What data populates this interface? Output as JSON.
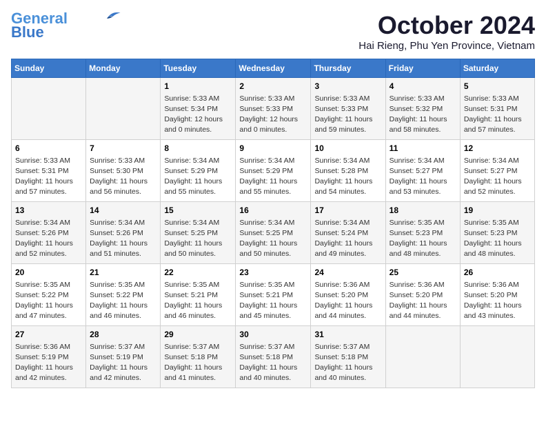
{
  "logo": {
    "line1": "General",
    "line2": "Blue"
  },
  "title": "October 2024",
  "location": "Hai Rieng, Phu Yen Province, Vietnam",
  "days_header": [
    "Sunday",
    "Monday",
    "Tuesday",
    "Wednesday",
    "Thursday",
    "Friday",
    "Saturday"
  ],
  "weeks": [
    [
      {
        "day": "",
        "info": ""
      },
      {
        "day": "",
        "info": ""
      },
      {
        "day": "1",
        "info": "Sunrise: 5:33 AM\nSunset: 5:34 PM\nDaylight: 12 hours\nand 0 minutes."
      },
      {
        "day": "2",
        "info": "Sunrise: 5:33 AM\nSunset: 5:33 PM\nDaylight: 12 hours\nand 0 minutes."
      },
      {
        "day": "3",
        "info": "Sunrise: 5:33 AM\nSunset: 5:33 PM\nDaylight: 11 hours\nand 59 minutes."
      },
      {
        "day": "4",
        "info": "Sunrise: 5:33 AM\nSunset: 5:32 PM\nDaylight: 11 hours\nand 58 minutes."
      },
      {
        "day": "5",
        "info": "Sunrise: 5:33 AM\nSunset: 5:31 PM\nDaylight: 11 hours\nand 57 minutes."
      }
    ],
    [
      {
        "day": "6",
        "info": "Sunrise: 5:33 AM\nSunset: 5:31 PM\nDaylight: 11 hours\nand 57 minutes."
      },
      {
        "day": "7",
        "info": "Sunrise: 5:33 AM\nSunset: 5:30 PM\nDaylight: 11 hours\nand 56 minutes."
      },
      {
        "day": "8",
        "info": "Sunrise: 5:34 AM\nSunset: 5:29 PM\nDaylight: 11 hours\nand 55 minutes."
      },
      {
        "day": "9",
        "info": "Sunrise: 5:34 AM\nSunset: 5:29 PM\nDaylight: 11 hours\nand 55 minutes."
      },
      {
        "day": "10",
        "info": "Sunrise: 5:34 AM\nSunset: 5:28 PM\nDaylight: 11 hours\nand 54 minutes."
      },
      {
        "day": "11",
        "info": "Sunrise: 5:34 AM\nSunset: 5:27 PM\nDaylight: 11 hours\nand 53 minutes."
      },
      {
        "day": "12",
        "info": "Sunrise: 5:34 AM\nSunset: 5:27 PM\nDaylight: 11 hours\nand 52 minutes."
      }
    ],
    [
      {
        "day": "13",
        "info": "Sunrise: 5:34 AM\nSunset: 5:26 PM\nDaylight: 11 hours\nand 52 minutes."
      },
      {
        "day": "14",
        "info": "Sunrise: 5:34 AM\nSunset: 5:26 PM\nDaylight: 11 hours\nand 51 minutes."
      },
      {
        "day": "15",
        "info": "Sunrise: 5:34 AM\nSunset: 5:25 PM\nDaylight: 11 hours\nand 50 minutes."
      },
      {
        "day": "16",
        "info": "Sunrise: 5:34 AM\nSunset: 5:25 PM\nDaylight: 11 hours\nand 50 minutes."
      },
      {
        "day": "17",
        "info": "Sunrise: 5:34 AM\nSunset: 5:24 PM\nDaylight: 11 hours\nand 49 minutes."
      },
      {
        "day": "18",
        "info": "Sunrise: 5:35 AM\nSunset: 5:23 PM\nDaylight: 11 hours\nand 48 minutes."
      },
      {
        "day": "19",
        "info": "Sunrise: 5:35 AM\nSunset: 5:23 PM\nDaylight: 11 hours\nand 48 minutes."
      }
    ],
    [
      {
        "day": "20",
        "info": "Sunrise: 5:35 AM\nSunset: 5:22 PM\nDaylight: 11 hours\nand 47 minutes."
      },
      {
        "day": "21",
        "info": "Sunrise: 5:35 AM\nSunset: 5:22 PM\nDaylight: 11 hours\nand 46 minutes."
      },
      {
        "day": "22",
        "info": "Sunrise: 5:35 AM\nSunset: 5:21 PM\nDaylight: 11 hours\nand 46 minutes."
      },
      {
        "day": "23",
        "info": "Sunrise: 5:35 AM\nSunset: 5:21 PM\nDaylight: 11 hours\nand 45 minutes."
      },
      {
        "day": "24",
        "info": "Sunrise: 5:36 AM\nSunset: 5:20 PM\nDaylight: 11 hours\nand 44 minutes."
      },
      {
        "day": "25",
        "info": "Sunrise: 5:36 AM\nSunset: 5:20 PM\nDaylight: 11 hours\nand 44 minutes."
      },
      {
        "day": "26",
        "info": "Sunrise: 5:36 AM\nSunset: 5:20 PM\nDaylight: 11 hours\nand 43 minutes."
      }
    ],
    [
      {
        "day": "27",
        "info": "Sunrise: 5:36 AM\nSunset: 5:19 PM\nDaylight: 11 hours\nand 42 minutes."
      },
      {
        "day": "28",
        "info": "Sunrise: 5:37 AM\nSunset: 5:19 PM\nDaylight: 11 hours\nand 42 minutes."
      },
      {
        "day": "29",
        "info": "Sunrise: 5:37 AM\nSunset: 5:18 PM\nDaylight: 11 hours\nand 41 minutes."
      },
      {
        "day": "30",
        "info": "Sunrise: 5:37 AM\nSunset: 5:18 PM\nDaylight: 11 hours\nand 40 minutes."
      },
      {
        "day": "31",
        "info": "Sunrise: 5:37 AM\nSunset: 5:18 PM\nDaylight: 11 hours\nand 40 minutes."
      },
      {
        "day": "",
        "info": ""
      },
      {
        "day": "",
        "info": ""
      }
    ]
  ]
}
